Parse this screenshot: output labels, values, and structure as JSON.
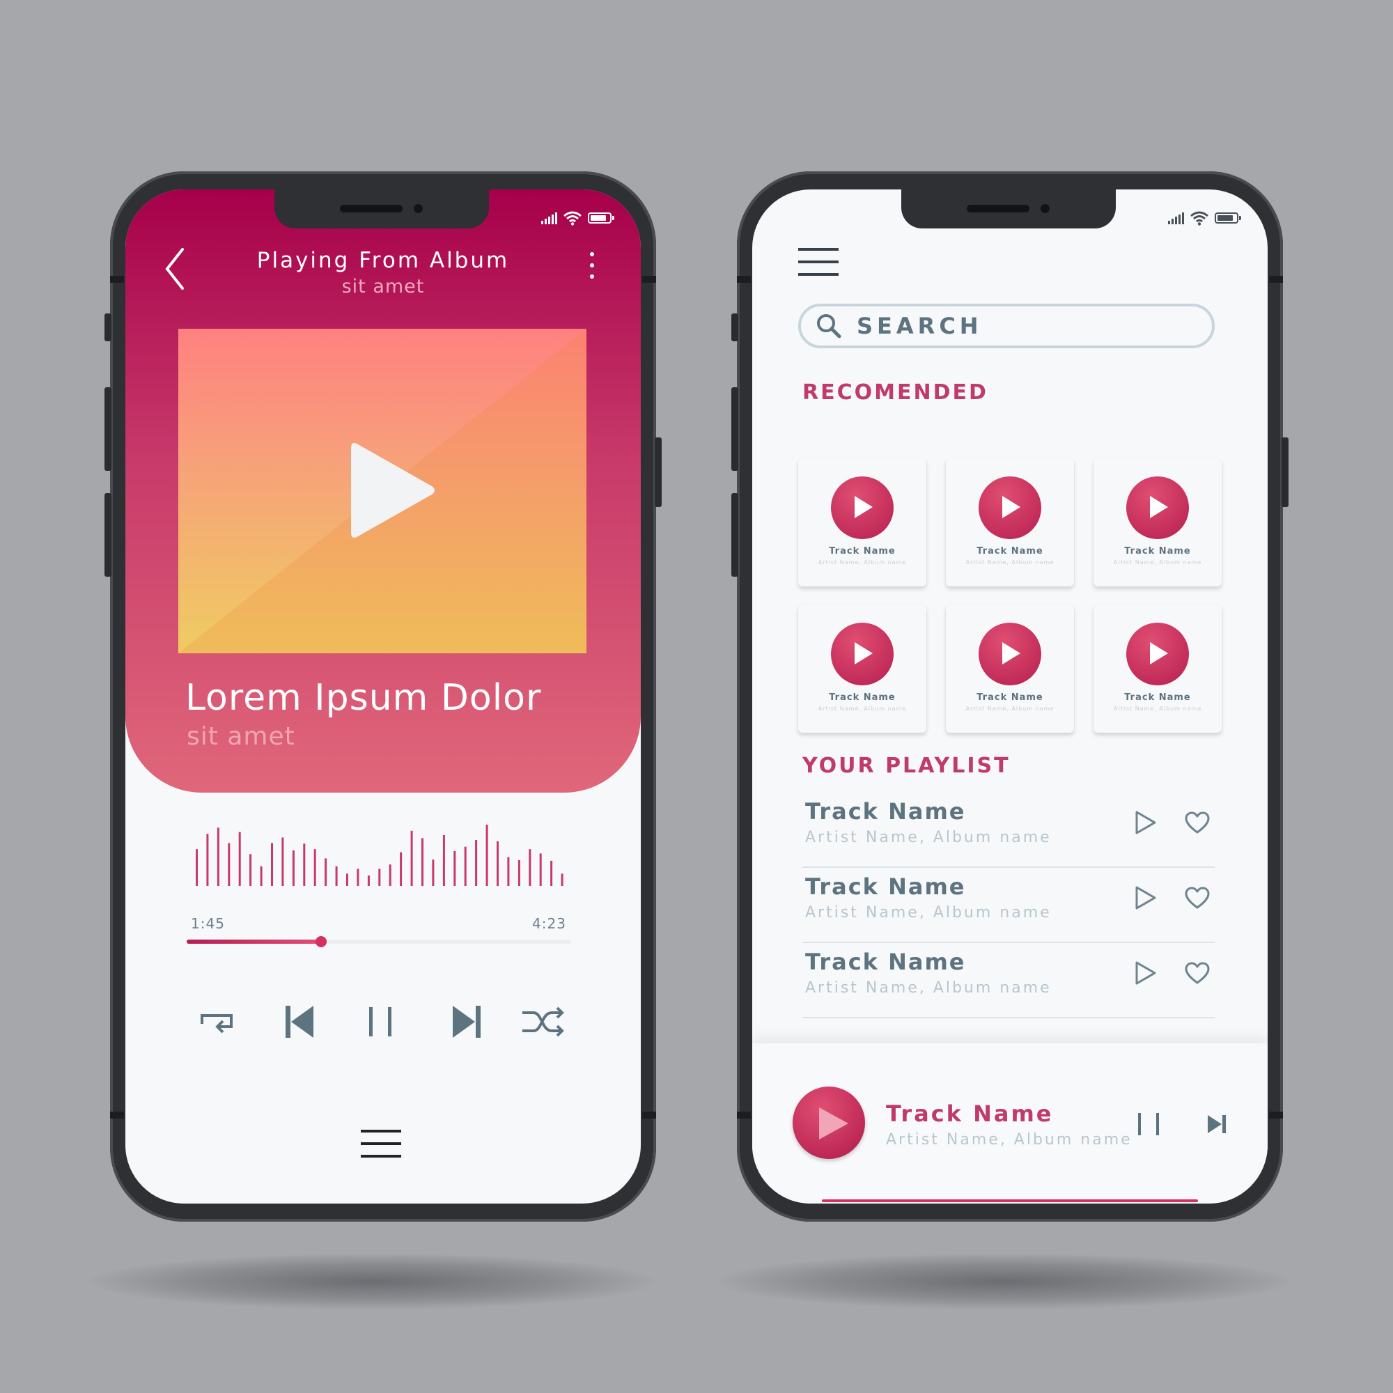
{
  "player": {
    "header_title": "Playing From Album",
    "header_subtitle": "sit amet",
    "song_title": "Lorem Ipsum Dolor",
    "song_subtitle": "sit amet",
    "time_elapsed": "1:45",
    "time_total": "4:23",
    "progress_fraction": 0.35,
    "waveform_levels": [
      0.6,
      0.85,
      0.95,
      0.7,
      0.88,
      0.52,
      0.32,
      0.7,
      0.79,
      0.58,
      0.69,
      0.6,
      0.45,
      0.32,
      0.2,
      0.28,
      0.17,
      0.28,
      0.35,
      0.55,
      0.9,
      0.78,
      0.43,
      0.83,
      0.57,
      0.64,
      0.75,
      1.0,
      0.73,
      0.47,
      0.42,
      0.6,
      0.53,
      0.41,
      0.2
    ]
  },
  "library": {
    "search_placeholder": "SEARCH",
    "recommended_title": "RECOMENDED",
    "recommended": [
      {
        "track": "Track Name",
        "artist": "Artist Name, Album name"
      },
      {
        "track": "Track Name",
        "artist": "Artist Name, Album name"
      },
      {
        "track": "Track Name",
        "artist": "Artist Name, Album name"
      },
      {
        "track": "Track Name",
        "artist": "Artist Name, Album name"
      },
      {
        "track": "Track Name",
        "artist": "Artist Name, Album name"
      },
      {
        "track": "Track Name",
        "artist": "Artist Name, Album name"
      }
    ],
    "playlist_title": "YOUR PLAYLIST",
    "playlist": [
      {
        "track": "Track Name",
        "artist": "Artist Name, Album name"
      },
      {
        "track": "Track Name",
        "artist": "Artist Name, Album name"
      },
      {
        "track": "Track Name",
        "artist": "Artist Name, Album name"
      }
    ],
    "now_playing": {
      "track": "Track Name",
      "artist": "Artist Name, Album name"
    }
  },
  "colors": {
    "accent": "#c03a6a",
    "hero_top": "#a6004a",
    "hero_bottom": "#e0677a",
    "text_muted": "#5e7380"
  },
  "icons": [
    "signal-icon",
    "wifi-icon",
    "battery-icon",
    "back-chevron-icon",
    "more-vertical-icon",
    "play-icon",
    "repeat-icon",
    "previous-icon",
    "pause-icon",
    "next-icon",
    "shuffle-icon",
    "menu-icon",
    "search-icon",
    "heart-icon"
  ]
}
